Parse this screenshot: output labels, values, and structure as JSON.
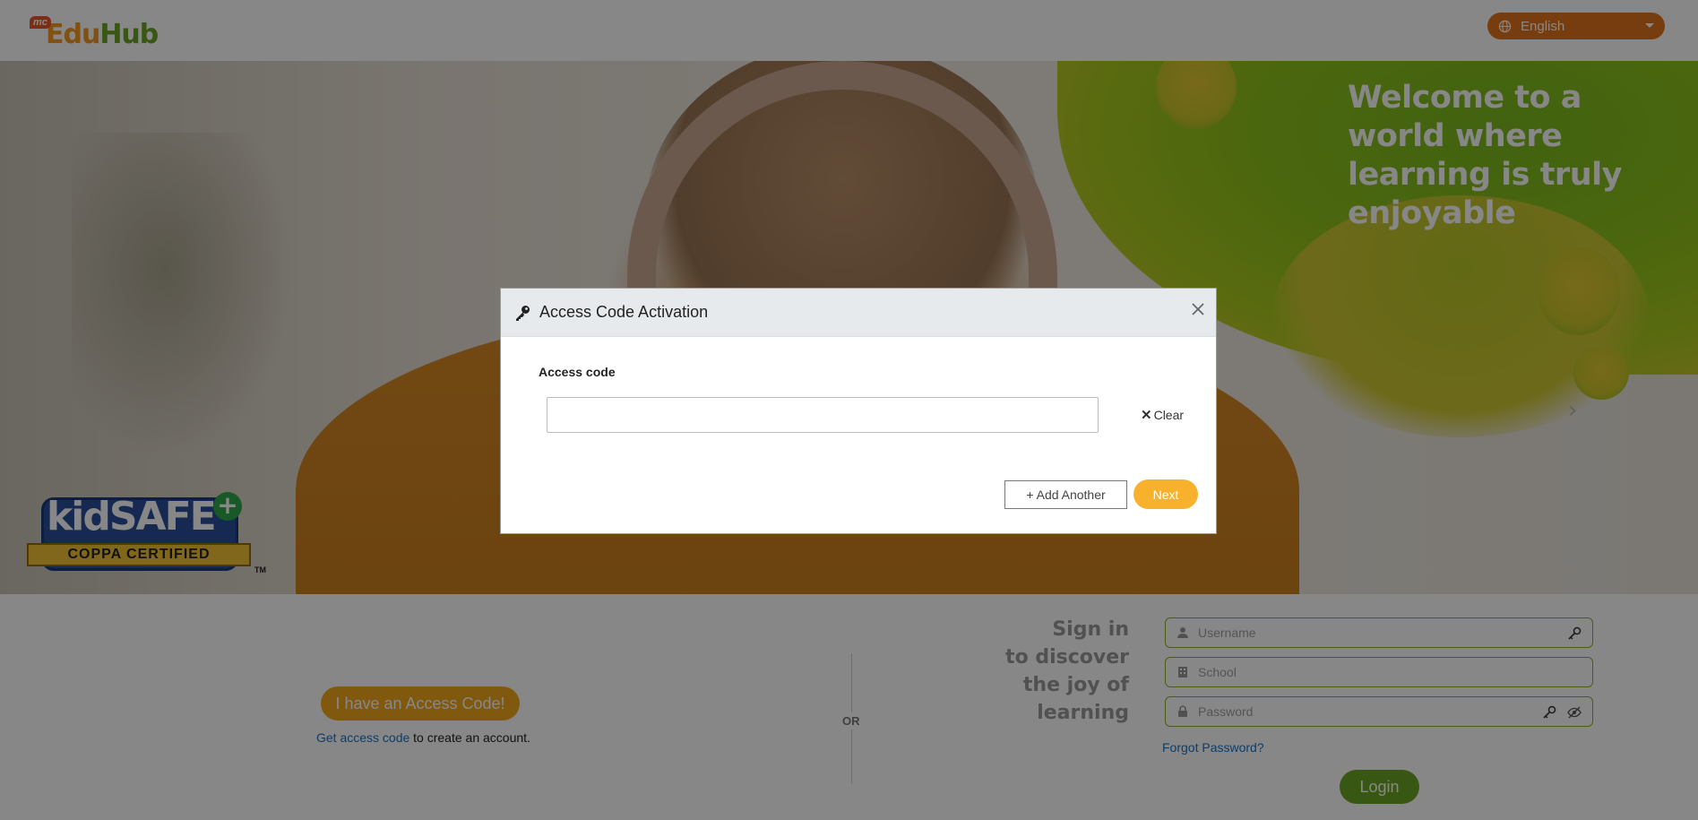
{
  "header": {
    "logo_badge": "mc",
    "logo_part1": "Edu",
    "logo_part2": "Hub",
    "language": "English"
  },
  "hero": {
    "welcome_text": "Welcome to a world where learning is truly enjoyable",
    "kidsafe_word1": "kid",
    "kidsafe_word2": "SAFE",
    "kidsafe_ribbon": "COPPA CERTIFIED",
    "kidsafe_tm": "TM"
  },
  "access": {
    "button_label": "I have an Access Code!",
    "get_code_link": "Get access code",
    "get_code_suffix": " to create an account."
  },
  "divider": {
    "or_label": "OR"
  },
  "signin": {
    "heading_line1": "Sign in",
    "heading_line2": "to discover",
    "heading_line3": "the joy of",
    "heading_line4": "learning",
    "username_placeholder": "Username",
    "school_placeholder": "School",
    "password_placeholder": "Password",
    "forgot_label": "Forgot Password?",
    "login_label": "Login"
  },
  "modal": {
    "title": "Access Code Activation",
    "field_label": "Access code",
    "input_value": "",
    "clear_label": "Clear",
    "add_another_label": "+ Add Another",
    "next_label": "Next"
  },
  "colors": {
    "brand_orange": "#f2a81d",
    "brand_green": "#6aa524",
    "link_blue": "#1a73c8"
  }
}
